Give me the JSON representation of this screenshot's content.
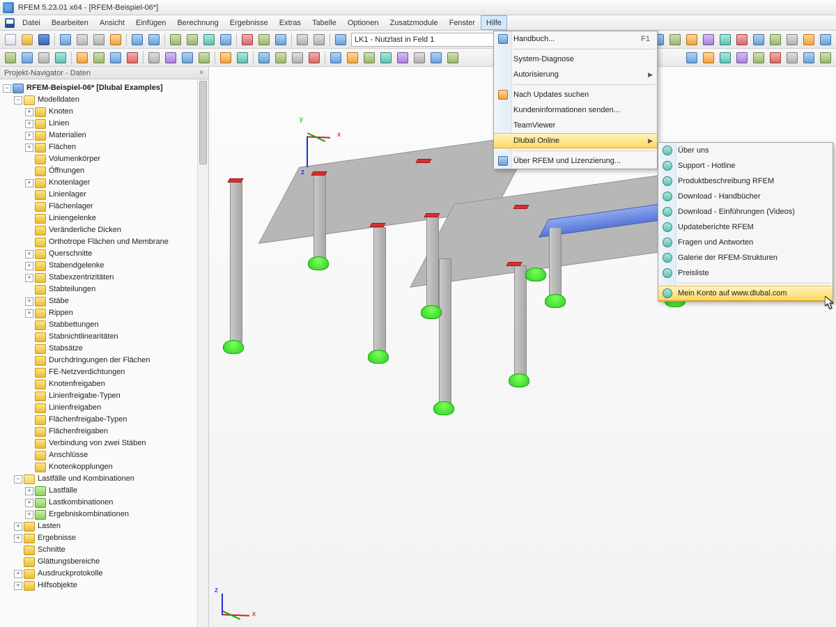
{
  "app": {
    "title": "RFEM 5.23.01 x64 - [RFEM-Beispiel-06*]"
  },
  "menubar": {
    "items": [
      "Datei",
      "Bearbeiten",
      "Ansicht",
      "Einfügen",
      "Berechnung",
      "Ergebnisse",
      "Extras",
      "Tabelle",
      "Optionen",
      "Zusatzmodule",
      "Fenster",
      "Hilfe"
    ]
  },
  "loadcase": {
    "text": "LK1 - Nutzlast in Feld 1"
  },
  "navigator": {
    "title": "Projekt-Navigator - Daten",
    "root": "RFEM-Beispiel-06* [Dlubal Examples]",
    "sec_modelldaten": "Modelldaten",
    "modelldaten": [
      {
        "l": "Knoten",
        "e": "+"
      },
      {
        "l": "Linien",
        "e": "+"
      },
      {
        "l": "Materialien",
        "e": "+"
      },
      {
        "l": "Flächen",
        "e": "+"
      },
      {
        "l": "Volumenkörper",
        "e": ""
      },
      {
        "l": "Öffnungen",
        "e": ""
      },
      {
        "l": "Knotenlager",
        "e": "+"
      },
      {
        "l": "Linienlager",
        "e": ""
      },
      {
        "l": "Flächenlager",
        "e": ""
      },
      {
        "l": "Liniengelenke",
        "e": ""
      },
      {
        "l": "Veränderliche Dicken",
        "e": ""
      },
      {
        "l": "Orthotrope Flächen und Membrane",
        "e": ""
      },
      {
        "l": "Querschnitte",
        "e": "+"
      },
      {
        "l": "Stabendgelenke",
        "e": "+"
      },
      {
        "l": "Stabexzentrizitäten",
        "e": "+"
      },
      {
        "l": "Stabteilungen",
        "e": ""
      },
      {
        "l": "Stäbe",
        "e": "+"
      },
      {
        "l": "Rippen",
        "e": "+"
      },
      {
        "l": "Stabbettungen",
        "e": ""
      },
      {
        "l": "Stabnichtlinearitäten",
        "e": ""
      },
      {
        "l": "Stabsätze",
        "e": ""
      },
      {
        "l": "Durchdringungen der Flächen",
        "e": ""
      },
      {
        "l": "FE-Netzverdichtungen",
        "e": ""
      },
      {
        "l": "Knotenfreigaben",
        "e": ""
      },
      {
        "l": "Linienfreigabe-Typen",
        "e": ""
      },
      {
        "l": "Linienfreigaben",
        "e": ""
      },
      {
        "l": "Flächenfreigabe-Typen",
        "e": ""
      },
      {
        "l": "Flächenfreigaben",
        "e": ""
      },
      {
        "l": "Verbindung von zwei Stäben",
        "e": ""
      },
      {
        "l": "Anschlüsse",
        "e": ""
      },
      {
        "l": "Knotenkopplungen",
        "e": ""
      }
    ],
    "sec_lastfaelle": "Lastfälle und Kombinationen",
    "lastfaelle": [
      {
        "l": "Lastfälle",
        "e": "+",
        "ic": "green"
      },
      {
        "l": "Lastkombinationen",
        "e": "+",
        "ic": "green"
      },
      {
        "l": "Ergebniskombinationen",
        "e": "+",
        "ic": "green"
      }
    ],
    "tail": [
      {
        "l": "Lasten",
        "e": "+"
      },
      {
        "l": "Ergebnisse",
        "e": "+"
      },
      {
        "l": "Schnitte",
        "e": ""
      },
      {
        "l": "Glättungsbereiche",
        "e": ""
      },
      {
        "l": "Ausdruckprotokolle",
        "e": "+"
      },
      {
        "l": "Hilfsobjekte",
        "e": "+"
      }
    ]
  },
  "help_menu": {
    "items": [
      {
        "l": "Handbuch...",
        "hotkey": "F1",
        "ic": "blue"
      },
      {
        "sep": true
      },
      {
        "l": "System-Diagnose"
      },
      {
        "l": "Autorisierung",
        "sub": true
      },
      {
        "sep": true
      },
      {
        "l": "Nach Updates suchen",
        "ic": "orange"
      },
      {
        "l": "Kundeninformationen senden..."
      },
      {
        "l": "TeamViewer"
      },
      {
        "l": "Dlubal Online",
        "sub": true,
        "hi": true
      },
      {
        "sep": true
      },
      {
        "l": "Über RFEM und Lizenzierung...",
        "ic": "blue"
      }
    ]
  },
  "dlubal_submenu": {
    "items": [
      {
        "l": "Über uns"
      },
      {
        "l": "Support - Hotline"
      },
      {
        "l": "Produktbeschreibung RFEM"
      },
      {
        "l": "Download - Handbücher"
      },
      {
        "l": "Download - Einführungen (Videos)"
      },
      {
        "l": "Updateberichte RFEM"
      },
      {
        "l": "Fragen und Antworten"
      },
      {
        "l": "Galerie der RFEM-Strukturen"
      },
      {
        "l": "Preisliste"
      },
      {
        "sep": true
      },
      {
        "l": "Mein Konto auf www.dlubal.com",
        "hi": true
      }
    ]
  },
  "axes": {
    "x": "x",
    "y": "y",
    "z": "z"
  }
}
